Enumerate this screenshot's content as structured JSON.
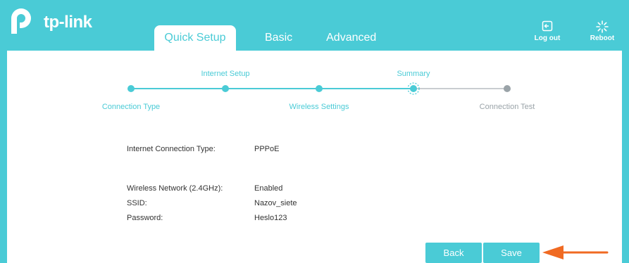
{
  "brand": {
    "name": "tp-link"
  },
  "tabs": [
    {
      "label": "Quick Setup",
      "active": true
    },
    {
      "label": "Basic",
      "active": false
    },
    {
      "label": "Advanced",
      "active": false
    }
  ],
  "header_buttons": {
    "logout": "Log out",
    "reboot": "Reboot"
  },
  "steps": [
    {
      "label": "Connection Type",
      "state": "done"
    },
    {
      "label": "Internet Setup",
      "state": "done"
    },
    {
      "label": "Wireless Settings",
      "state": "done"
    },
    {
      "label": "Summary",
      "state": "current"
    },
    {
      "label": "Connection Test",
      "state": "pending"
    }
  ],
  "summary": {
    "connection_type_label": "Internet Connection Type:",
    "connection_type_value": "PPPoE",
    "wireless_label": "Wireless Network (2.4GHz):",
    "wireless_value": "Enabled",
    "ssid_label": "SSID:",
    "ssid_value": "Nazov_siete",
    "password_label": "Password:",
    "password_value": "Heslo123"
  },
  "buttons": {
    "back": "Back",
    "save": "Save"
  },
  "colors": {
    "accent": "#4acbd6",
    "arrow": "#f06a22",
    "pending": "#9aa3a8"
  }
}
